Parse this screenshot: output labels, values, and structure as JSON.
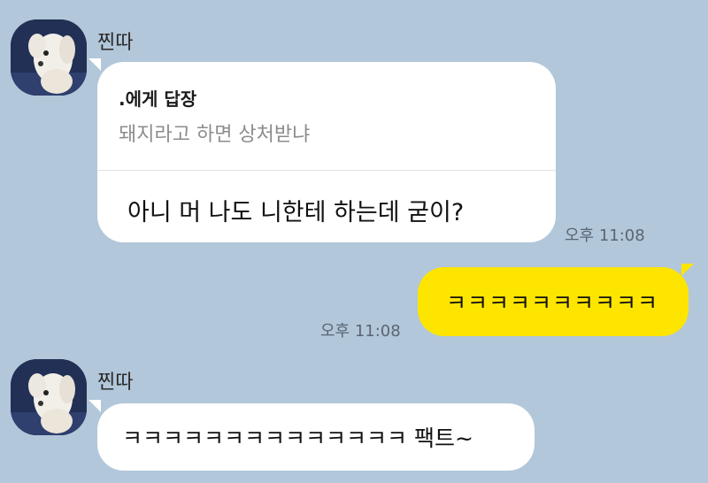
{
  "messages": [
    {
      "sender": "찐따",
      "reply": {
        "to": ".에게 답장",
        "quote": "돼지라고 하면 상처받냐"
      },
      "text": "아니 머 나도 니한테 하는데 굳이?",
      "time": "오후 11:08"
    },
    {
      "sender": "me",
      "text": "ㅋㅋㅋㅋㅋㅋㅋㅋㅋㅋ",
      "time": "오후 11:08"
    },
    {
      "sender": "찐따",
      "text": "ㅋㅋㅋㅋㅋㅋㅋㅋㅋㅋㅋㅋㅋㅋ 팩트~"
    }
  ],
  "colors": {
    "background": "#b2c7da",
    "my_bubble": "#fee500",
    "their_bubble": "#ffffff"
  },
  "icons": {
    "avatar": "white-puppy-avatar"
  }
}
